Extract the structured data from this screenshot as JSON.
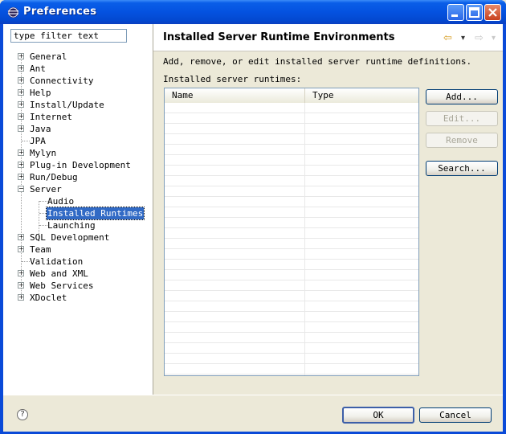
{
  "window": {
    "title": "Preferences"
  },
  "filter": {
    "value": "type filter text"
  },
  "tree": [
    {
      "label": "General",
      "expander": "+"
    },
    {
      "label": "Ant",
      "expander": "+"
    },
    {
      "label": "Connectivity",
      "expander": "+"
    },
    {
      "label": "Help",
      "expander": "+"
    },
    {
      "label": "Install/Update",
      "expander": "+"
    },
    {
      "label": "Internet",
      "expander": "+"
    },
    {
      "label": "Java",
      "expander": "+"
    },
    {
      "label": "JPA",
      "expander": ""
    },
    {
      "label": "Mylyn",
      "expander": "+"
    },
    {
      "label": "Plug-in Development",
      "expander": "+"
    },
    {
      "label": "Run/Debug",
      "expander": "+"
    },
    {
      "label": "Server",
      "expander": "−",
      "children": [
        {
          "label": "Audio"
        },
        {
          "label": "Installed Runtimes",
          "selected": true
        },
        {
          "label": "Launching"
        }
      ]
    },
    {
      "label": "SQL Development",
      "expander": "+"
    },
    {
      "label": "Team",
      "expander": "+"
    },
    {
      "label": "Validation",
      "expander": ""
    },
    {
      "label": "Web and XML",
      "expander": "+"
    },
    {
      "label": "Web Services",
      "expander": "+"
    },
    {
      "label": "XDoclet",
      "expander": "+"
    }
  ],
  "page": {
    "title": "Installed Server Runtime Environments",
    "description": "Add, remove, or edit installed server runtime definitions.",
    "table_label": "Installed server runtimes:",
    "columns": [
      "Name",
      "Type"
    ],
    "rows": []
  },
  "nav": {
    "back": "⇦",
    "back_dropdown": "▾",
    "forward": "⇨",
    "forward_dropdown": "▾"
  },
  "buttons": {
    "add": "Add...",
    "edit": "Edit...",
    "remove": "Remove",
    "search": "Search...",
    "ok": "OK",
    "cancel": "Cancel",
    "help": "?"
  },
  "colors": {
    "title_bar": "#0452e0",
    "selection": "#316ac5",
    "dialog_bg": "#ece9d8"
  }
}
